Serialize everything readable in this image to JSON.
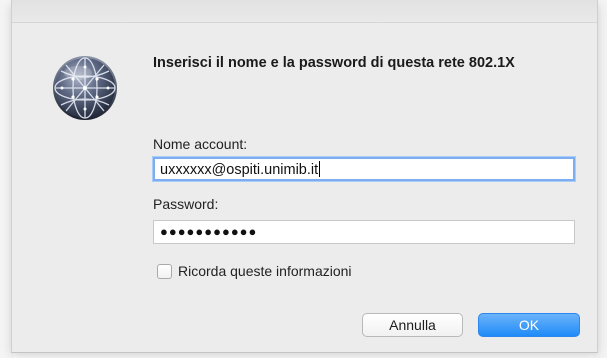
{
  "dialog": {
    "title": "Inserisci il nome e la password di questa rete 802.1X",
    "icon": "network-globe-icon"
  },
  "account": {
    "label": "Nome account:",
    "value": "uxxxxxx@ospiti.unimib.it"
  },
  "password": {
    "label": "Password:",
    "masked_value": "●●●●●●●●●●●"
  },
  "remember": {
    "label": "Ricorda queste informazioni",
    "checked": false
  },
  "buttons": {
    "cancel_label": "Annulla",
    "ok_label": "OK"
  },
  "colors": {
    "dialog_bg": "#ececec",
    "accent": "#1f8bf8",
    "focus_ring": "#7aaef0"
  }
}
